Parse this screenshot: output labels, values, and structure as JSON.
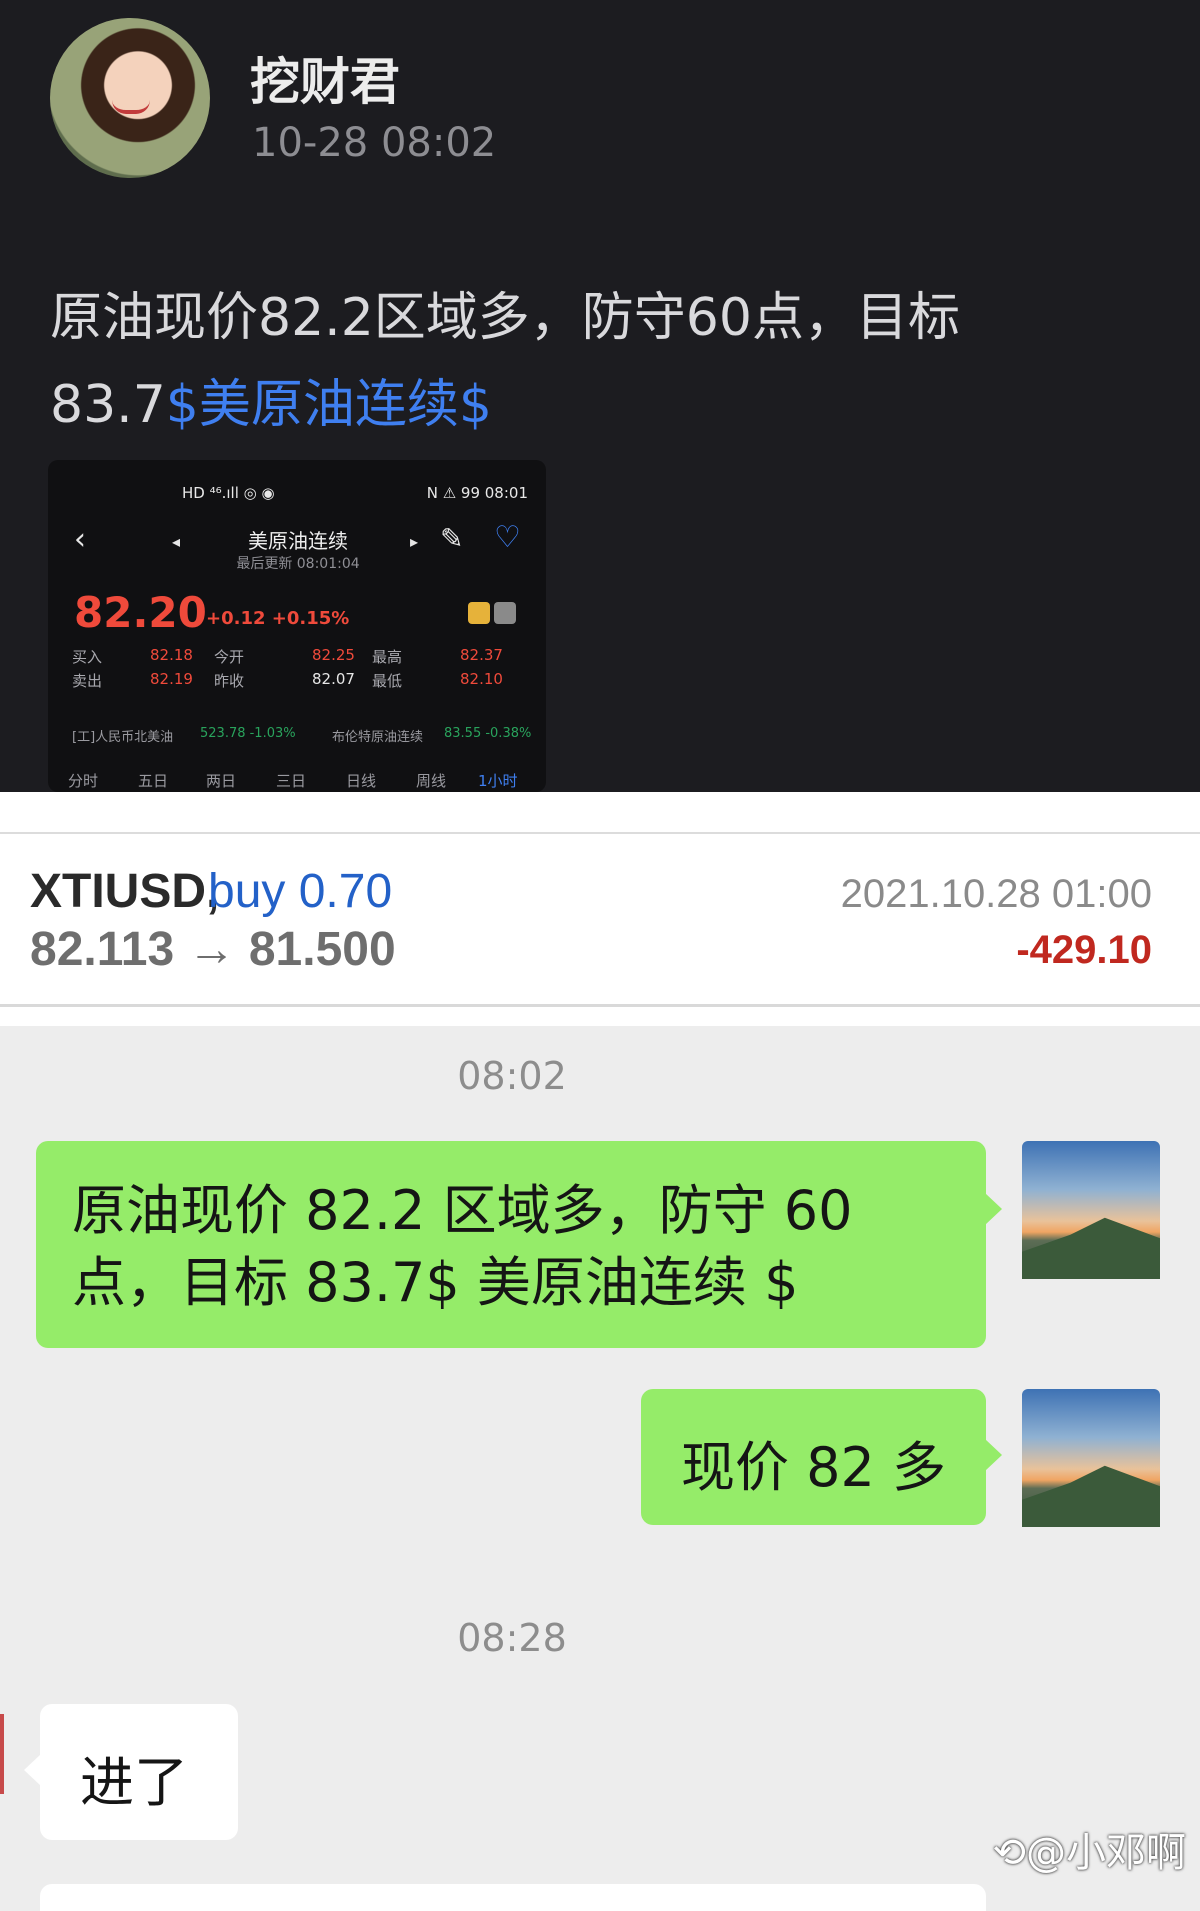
{
  "post": {
    "author": "挖财君",
    "time": "10-28 08:02",
    "text": "原油现价82.2区域多，防守60点，目标83.7",
    "tag": "$美原油连续$"
  },
  "quote": {
    "status_left": "HD ⁴⁶.ıll ◎ ◉",
    "status_right": "N ⚠ 99 08:01",
    "back": "‹",
    "prev": "◂",
    "next": "▸",
    "edit_icon": "✎",
    "heart_icon": "♡",
    "title": "美原油连续",
    "updated": "最后更新 08:01:04",
    "price": "82.20",
    "change": "+0.12 +0.15%",
    "rows": [
      {
        "l1": "买入",
        "v1": "82.18",
        "l2": "今开",
        "v2": "82.25",
        "l3": "最高",
        "v3": "82.37"
      },
      {
        "l1": "卖出",
        "v1": "82.19",
        "l2": "昨收",
        "v2": "82.07",
        "l3": "最低",
        "v3": "82.10"
      }
    ],
    "ticker_left_label": "[工]人民币北美油",
    "ticker_left_value": "523.78 -1.03%",
    "ticker_right_label": "布伦特原油连续",
    "ticker_right_value": "83.55 -0.38%",
    "tabs": [
      "分时",
      "五日",
      "两日",
      "三日",
      "日线",
      "周线",
      "1小时"
    ]
  },
  "trade": {
    "symbol": "XTIUSD,",
    "direction": "buy 0.70",
    "prices": "82.113 → 81.500",
    "datetime": "2021.10.28 01:00",
    "pl": "-429.10"
  },
  "chat": {
    "time1": "08:02",
    "msg1": "原油现价 82.2 区域多，防守 60 点，目标 83.7$ 美原油连续 $",
    "msg2": "现价 82 多",
    "time2": "08:28",
    "reply": "进了",
    "watermark": "⟲@小邓啊"
  }
}
